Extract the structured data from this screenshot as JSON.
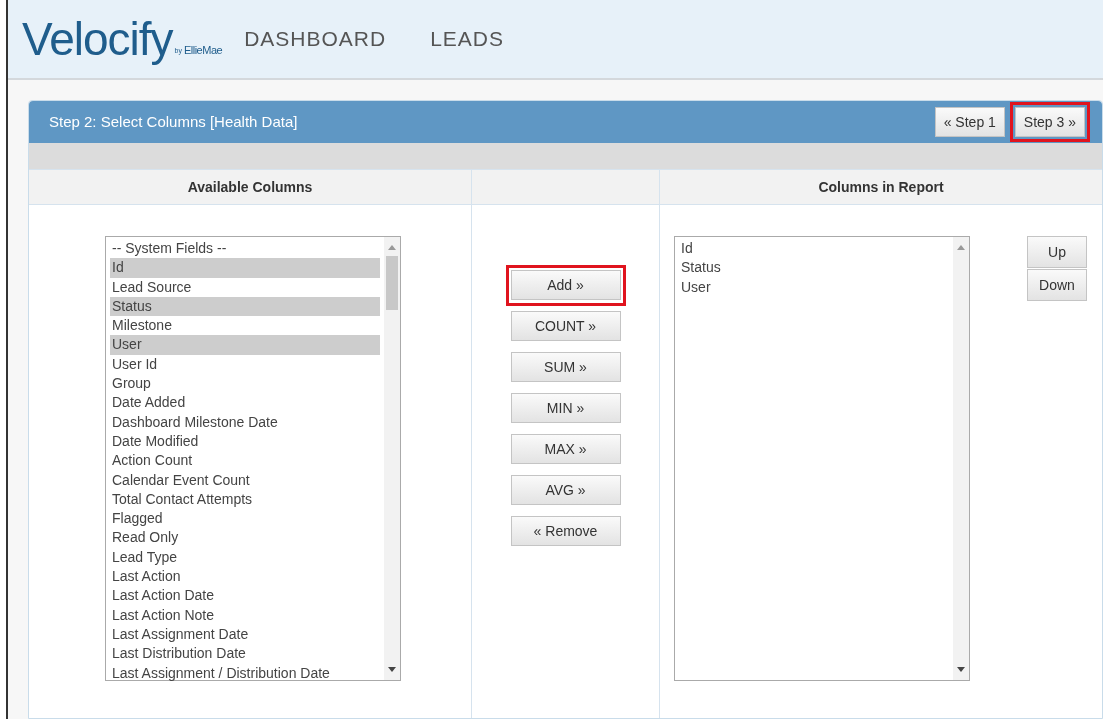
{
  "header": {
    "logo": {
      "name": "Velocify",
      "by": "by",
      "company": "EllieMae"
    },
    "nav": [
      {
        "label": "DASHBOARD"
      },
      {
        "label": "LEADS"
      }
    ]
  },
  "panel": {
    "title": "Step 2: Select Columns [Health Data]",
    "step_buttons": [
      {
        "label": "« Step 1",
        "highlighted": false
      },
      {
        "label": "Step 3 »",
        "highlighted": true
      }
    ],
    "columns": [
      "Available Columns",
      "",
      "Columns in Report"
    ],
    "available": [
      {
        "label": "-- System Fields --",
        "selected": false
      },
      {
        "label": "Id",
        "selected": true
      },
      {
        "label": "Lead Source",
        "selected": false
      },
      {
        "label": "Status",
        "selected": true
      },
      {
        "label": "Milestone",
        "selected": false
      },
      {
        "label": "User",
        "selected": true
      },
      {
        "label": "User Id",
        "selected": false
      },
      {
        "label": "Group",
        "selected": false
      },
      {
        "label": "Date Added",
        "selected": false
      },
      {
        "label": "Dashboard Milestone Date",
        "selected": false
      },
      {
        "label": "Date Modified",
        "selected": false
      },
      {
        "label": "Action Count",
        "selected": false
      },
      {
        "label": "Calendar Event Count",
        "selected": false
      },
      {
        "label": "Total Contact Attempts",
        "selected": false
      },
      {
        "label": "Flagged",
        "selected": false
      },
      {
        "label": "Read Only",
        "selected": false
      },
      {
        "label": "Lead Type",
        "selected": false
      },
      {
        "label": "Last Action",
        "selected": false
      },
      {
        "label": "Last Action Date",
        "selected": false
      },
      {
        "label": "Last Action Note",
        "selected": false
      },
      {
        "label": "Last Assignment Date",
        "selected": false
      },
      {
        "label": "Last Distribution Date",
        "selected": false
      },
      {
        "label": "Last Assignment / Distribution Date",
        "selected": false
      }
    ],
    "actions": [
      {
        "label": "Add »",
        "highlighted": true
      },
      {
        "label": "COUNT »",
        "highlighted": false
      },
      {
        "label": "SUM »",
        "highlighted": false
      },
      {
        "label": "MIN »",
        "highlighted": false
      },
      {
        "label": "MAX »",
        "highlighted": false
      },
      {
        "label": "AVG »",
        "highlighted": false
      },
      {
        "label": "« Remove",
        "highlighted": false
      }
    ],
    "in_report": [
      {
        "label": "Id",
        "selected": false
      },
      {
        "label": "Status",
        "selected": false
      },
      {
        "label": "User",
        "selected": false
      }
    ],
    "order_buttons": [
      {
        "label": "Up"
      },
      {
        "label": "Down"
      }
    ]
  }
}
